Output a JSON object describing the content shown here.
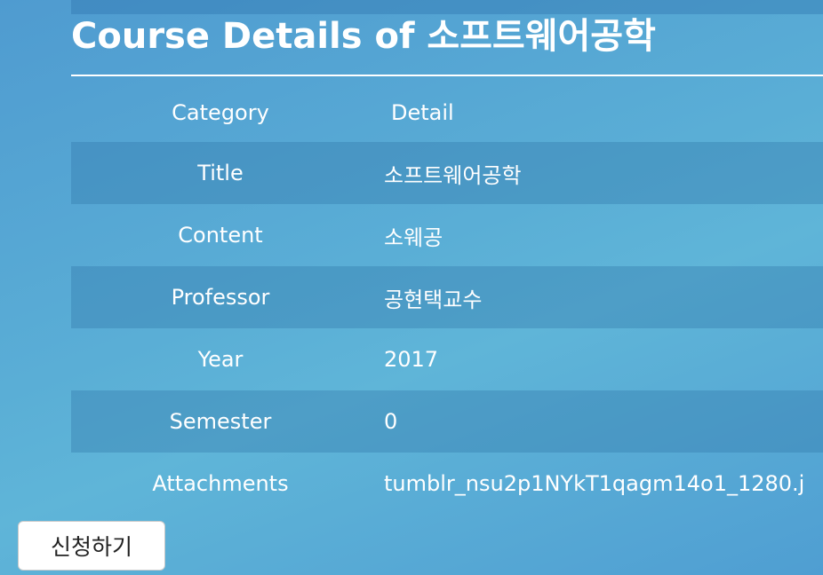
{
  "page": {
    "title": "Course Details of 소프트웨어공학"
  },
  "table": {
    "headers": {
      "category": "Category",
      "detail": "Detail"
    },
    "rows": [
      {
        "category": "Title",
        "detail": "소프트웨어공학"
      },
      {
        "category": "Content",
        "detail": "소웨공"
      },
      {
        "category": "Professor",
        "detail": "공현택교수"
      },
      {
        "category": "Year",
        "detail": "2017"
      },
      {
        "category": "Semester",
        "detail": "0"
      },
      {
        "category": "Attachments",
        "detail": "tumblr_nsu2p1NYkT1qagm14o1_1280.j"
      }
    ]
  },
  "actions": {
    "apply_label": "신청하기"
  }
}
